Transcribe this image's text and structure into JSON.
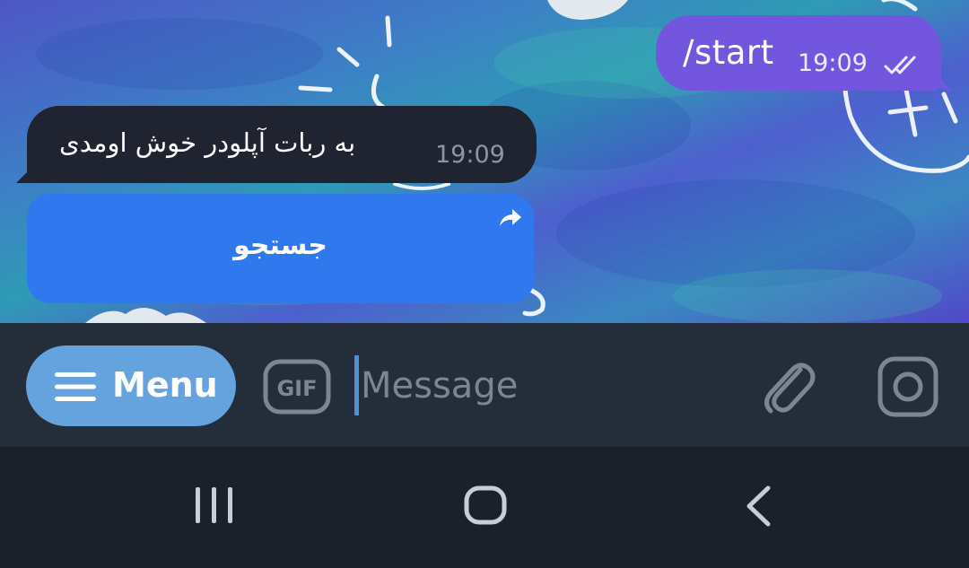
{
  "chat": {
    "messages": [
      {
        "direction": "outgoing",
        "text": "/start",
        "time": "19:09",
        "status": "read-double-check"
      },
      {
        "direction": "incoming",
        "text": "به ربات آپلودر خوش اومدی",
        "time": "19:09"
      }
    ],
    "inline_keyboard": {
      "button_label": "جستجو",
      "corner_icon": "share-arrow-icon"
    }
  },
  "input_bar": {
    "menu_label": "Menu",
    "menu_icon": "hamburger-icon",
    "gif_label": "GIF",
    "placeholder": "Message",
    "attach_icon": "paperclip-icon",
    "camera_icon": "camera-icon"
  },
  "system_nav": {
    "recents_icon": "recents-icon",
    "home_icon": "home-icon",
    "back_icon": "back-chevron-icon"
  },
  "colors": {
    "outgoing_bubble": "#7356de",
    "incoming_bubble": "#1f2430",
    "inline_button": "#2f78ee",
    "menu_button": "#64a3dd",
    "input_bar": "#242d3a",
    "nav_bar": "#1b2128"
  }
}
